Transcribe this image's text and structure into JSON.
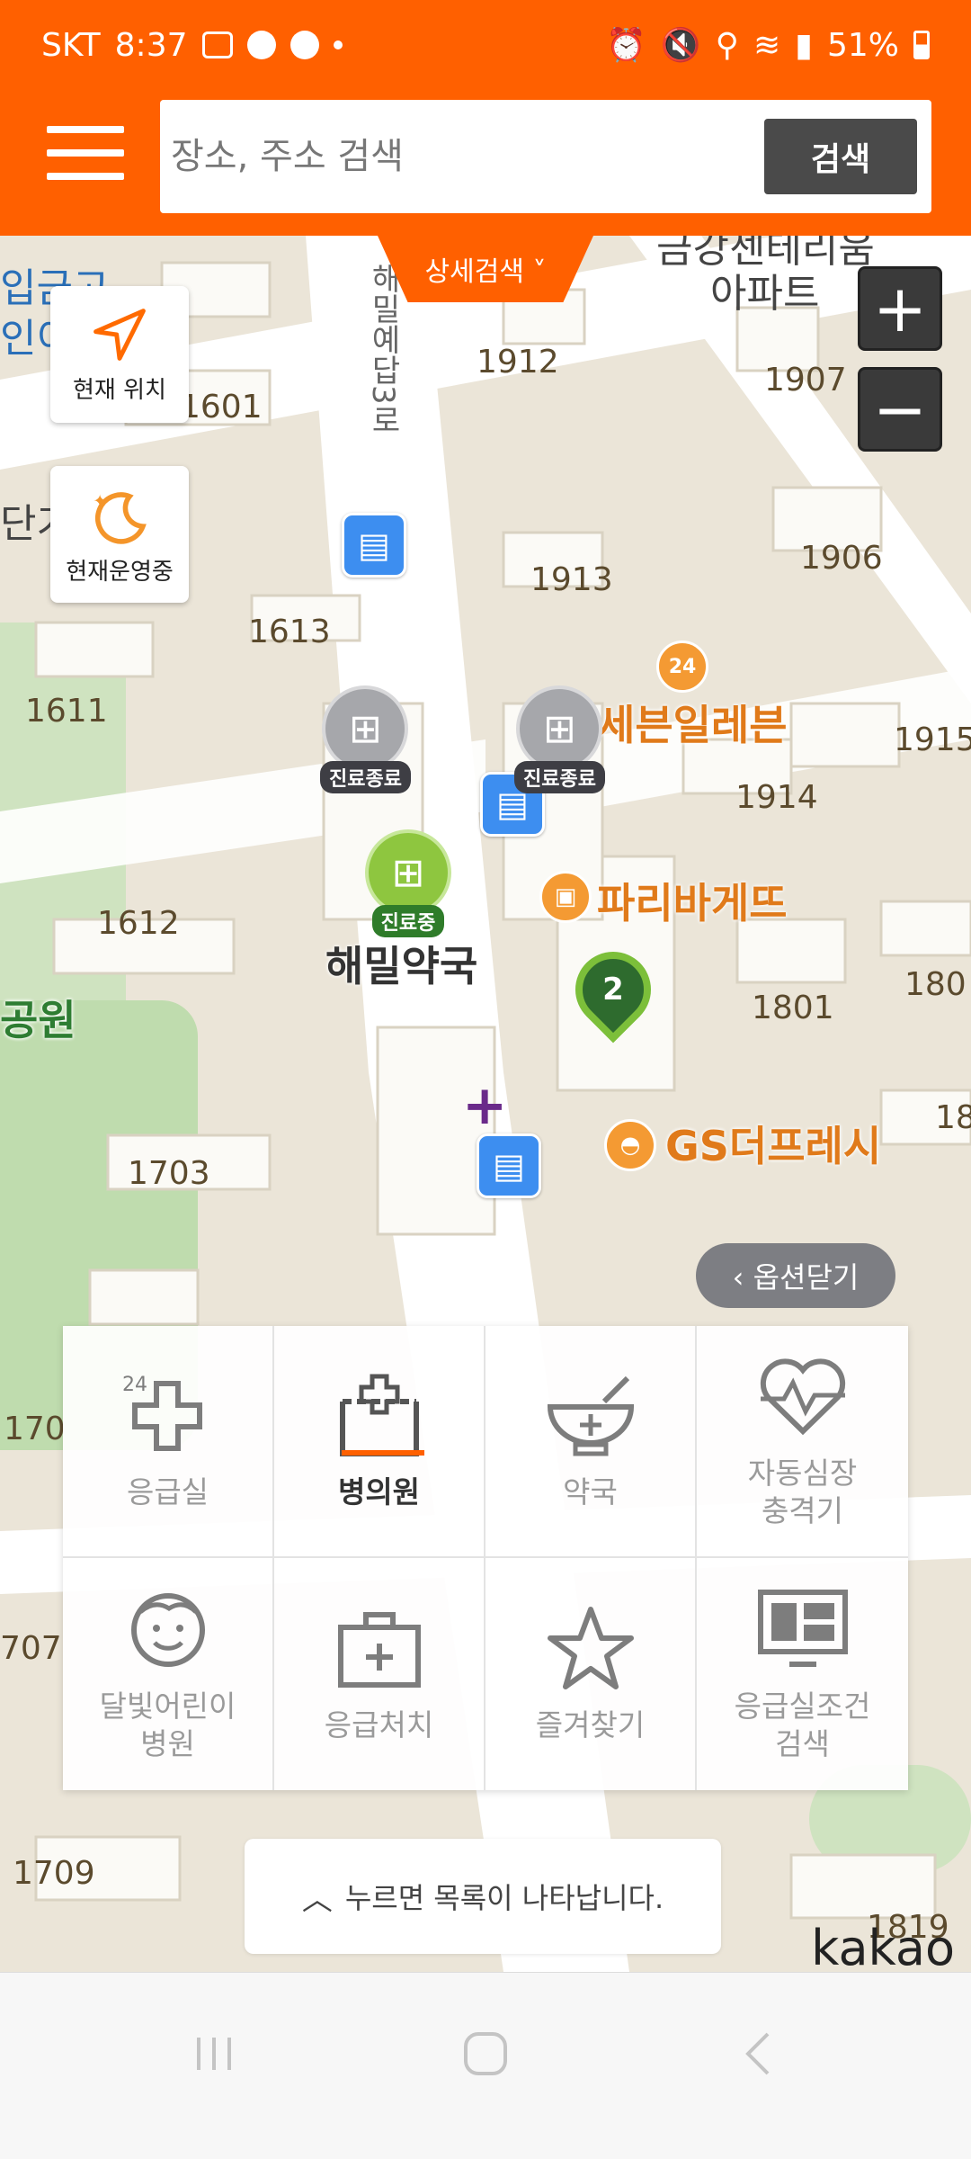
{
  "status_bar": {
    "carrier": "SKT",
    "time": "8:37",
    "battery": "51%"
  },
  "header": {
    "search_placeholder": "장소, 주소 검색",
    "search_button": "검색",
    "detail_search_tab": "상세검색 ˅"
  },
  "map_controls": {
    "current_location": "현재 위치",
    "open_now": "현재운영중",
    "zoom_in": "+",
    "zoom_out": "−",
    "options_close": "‹ 옵션닫기"
  },
  "map_labels": {
    "buildings": [
      "1912",
      "1907",
      "1601",
      "1913",
      "1906",
      "1613",
      "1611",
      "1915",
      "1914",
      "1612",
      "1801",
      "180",
      "1703",
      "18",
      "170",
      "707",
      "1709",
      "1819"
    ],
    "apt_top": "아파트",
    "apt_top2": "금강센테리움",
    "left_top": "입금고",
    "left_top2": "인이",
    "left_mid": "단기",
    "road": "해밀예답3로",
    "poi_711": "세븐일레븐",
    "poi_paris": "파리바게뜨",
    "poi_gs": "GS더프레시",
    "pharmacy": "해밀약국",
    "park": "공원",
    "bus_icon": "bus-stop",
    "badge_24": "24"
  },
  "markers": {
    "closed_tag": "진료종료",
    "open_tag": "진료중",
    "cluster_count": "2"
  },
  "categories": [
    {
      "label": "응급실",
      "icon": "emergency-24-icon"
    },
    {
      "label": "병의원",
      "icon": "hospital-icon"
    },
    {
      "label": "약국",
      "icon": "pharmacy-icon"
    },
    {
      "label": "자동심장\n충격기",
      "icon": "defibrillator-icon"
    },
    {
      "label": "달빛어린이\n병원",
      "icon": "child-hospital-icon"
    },
    {
      "label": "응급처치",
      "icon": "first-aid-icon"
    },
    {
      "label": "즐겨찾기",
      "icon": "star-icon"
    },
    {
      "label": "응급실조건\n검색",
      "icon": "er-condition-search-icon"
    }
  ],
  "bottom": {
    "list_hint": "누르면 목록이 나타납니다.",
    "brand": "kakao"
  },
  "colors": {
    "brand_orange": "#ff6000",
    "open_green": "#8ec63f",
    "closed_gray": "#a6a7ab"
  }
}
